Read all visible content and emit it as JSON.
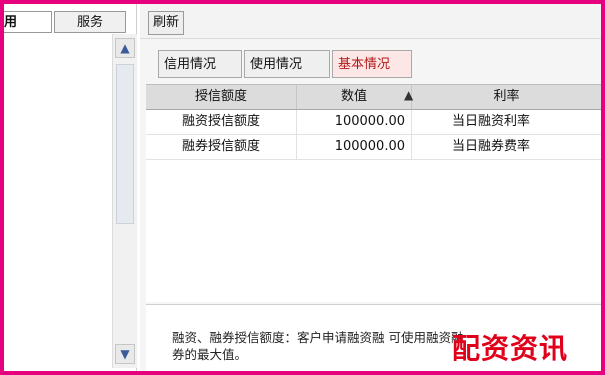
{
  "sidebar": {
    "tabs": [
      "用",
      "服务"
    ]
  },
  "toolbar": {
    "refresh_label": "刷新"
  },
  "tabs": [
    {
      "label": "信用情况"
    },
    {
      "label": "使用情况"
    },
    {
      "label": "基本情况"
    }
  ],
  "table": {
    "headers": [
      "授信额度",
      "数值",
      "利率"
    ],
    "rows": [
      [
        "融资授信额度",
        "100000.00",
        "当日融资利率"
      ],
      [
        "融券授信额度",
        "100000.00",
        "当日融券费率"
      ]
    ]
  },
  "note": {
    "text": "融资、融券授信额度：客户申请融资融 可使用融资融券的最大值。"
  },
  "watermark": "配资资讯",
  "colors": {
    "frame": "#e6007e",
    "active_tab": "#b01818",
    "watermark": "#e1001a"
  }
}
